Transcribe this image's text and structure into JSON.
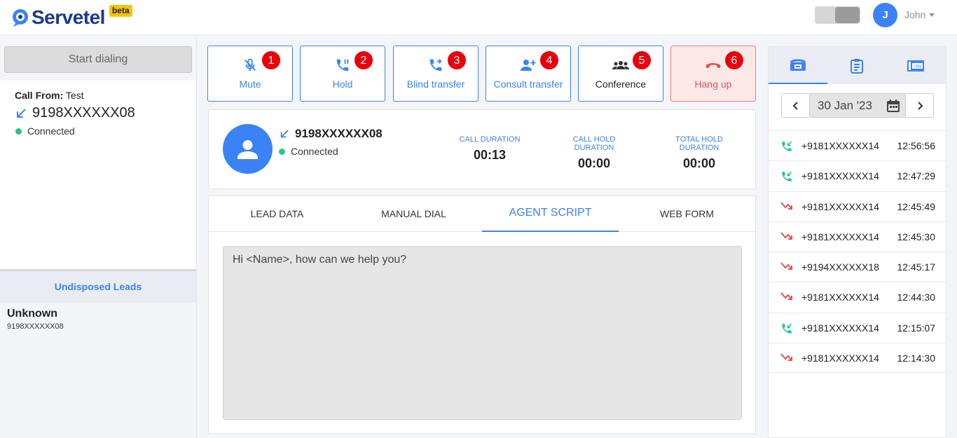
{
  "app": {
    "name": "Servetel",
    "badge": "beta"
  },
  "user": {
    "initial": "J",
    "name": "John"
  },
  "left": {
    "start_label": "Start dialing",
    "call_from_label": "Call From:",
    "call_from_value": "Test",
    "number": "9198XXXXXX08",
    "status": "Connected",
    "undisposed_title": "Undisposed Leads",
    "lead_name": "Unknown",
    "lead_number": "9198XXXXXX08"
  },
  "actions": [
    {
      "label": "Mute",
      "badge": "1",
      "icon": "mic-off-icon"
    },
    {
      "label": "Hold",
      "badge": "2",
      "icon": "phone-paused-icon"
    },
    {
      "label": "Blind transfer",
      "badge": "3",
      "icon": "phone-forwarded-icon"
    },
    {
      "label": "Consult transfer",
      "badge": "4",
      "icon": "person-add-icon"
    },
    {
      "label": "Conference",
      "badge": "5",
      "icon": "group-icon"
    },
    {
      "label": "Hang up",
      "badge": "6",
      "icon": "call-end-icon"
    }
  ],
  "call": {
    "number": "9198XXXXXX08",
    "status": "Connected",
    "stats": [
      {
        "label": "CALL DURATION",
        "value": "00:13"
      },
      {
        "label": "CALL HOLD DURATION",
        "value": "00:00"
      },
      {
        "label": "TOTAL HOLD DURATION",
        "value": "00:00"
      }
    ]
  },
  "tabs": [
    "LEAD DATA",
    "MANUAL DIAL",
    "AGENT SCRIPT",
    "WEB FORM"
  ],
  "active_tab": "AGENT SCRIPT",
  "script_text": "Hi <Name>, how can we help you?",
  "history": {
    "date": "30 Jan '23",
    "calls": [
      {
        "number": "+9181XXXXXX14",
        "time": "12:56:56",
        "type": "answered"
      },
      {
        "number": "+9181XXXXXX14",
        "time": "12:47:29",
        "type": "answered"
      },
      {
        "number": "+9181XXXXXX14",
        "time": "12:45:49",
        "type": "missed"
      },
      {
        "number": "+9181XXXXXX14",
        "time": "12:45:30",
        "type": "missed"
      },
      {
        "number": "+9194XXXXXX18",
        "time": "12:45:17",
        "type": "missed"
      },
      {
        "number": "+9181XXXXXX14",
        "time": "12:44:30",
        "type": "missed"
      },
      {
        "number": "+9181XXXXXX14",
        "time": "12:15:07",
        "type": "answered"
      },
      {
        "number": "+9181XXXXXX14",
        "time": "12:14:30",
        "type": "missed"
      }
    ]
  },
  "colors": {
    "primary": "#3b82f6",
    "brand": "#1b3a8c",
    "badge": "#e8000b",
    "success": "#27c490",
    "danger": "#e35353"
  }
}
